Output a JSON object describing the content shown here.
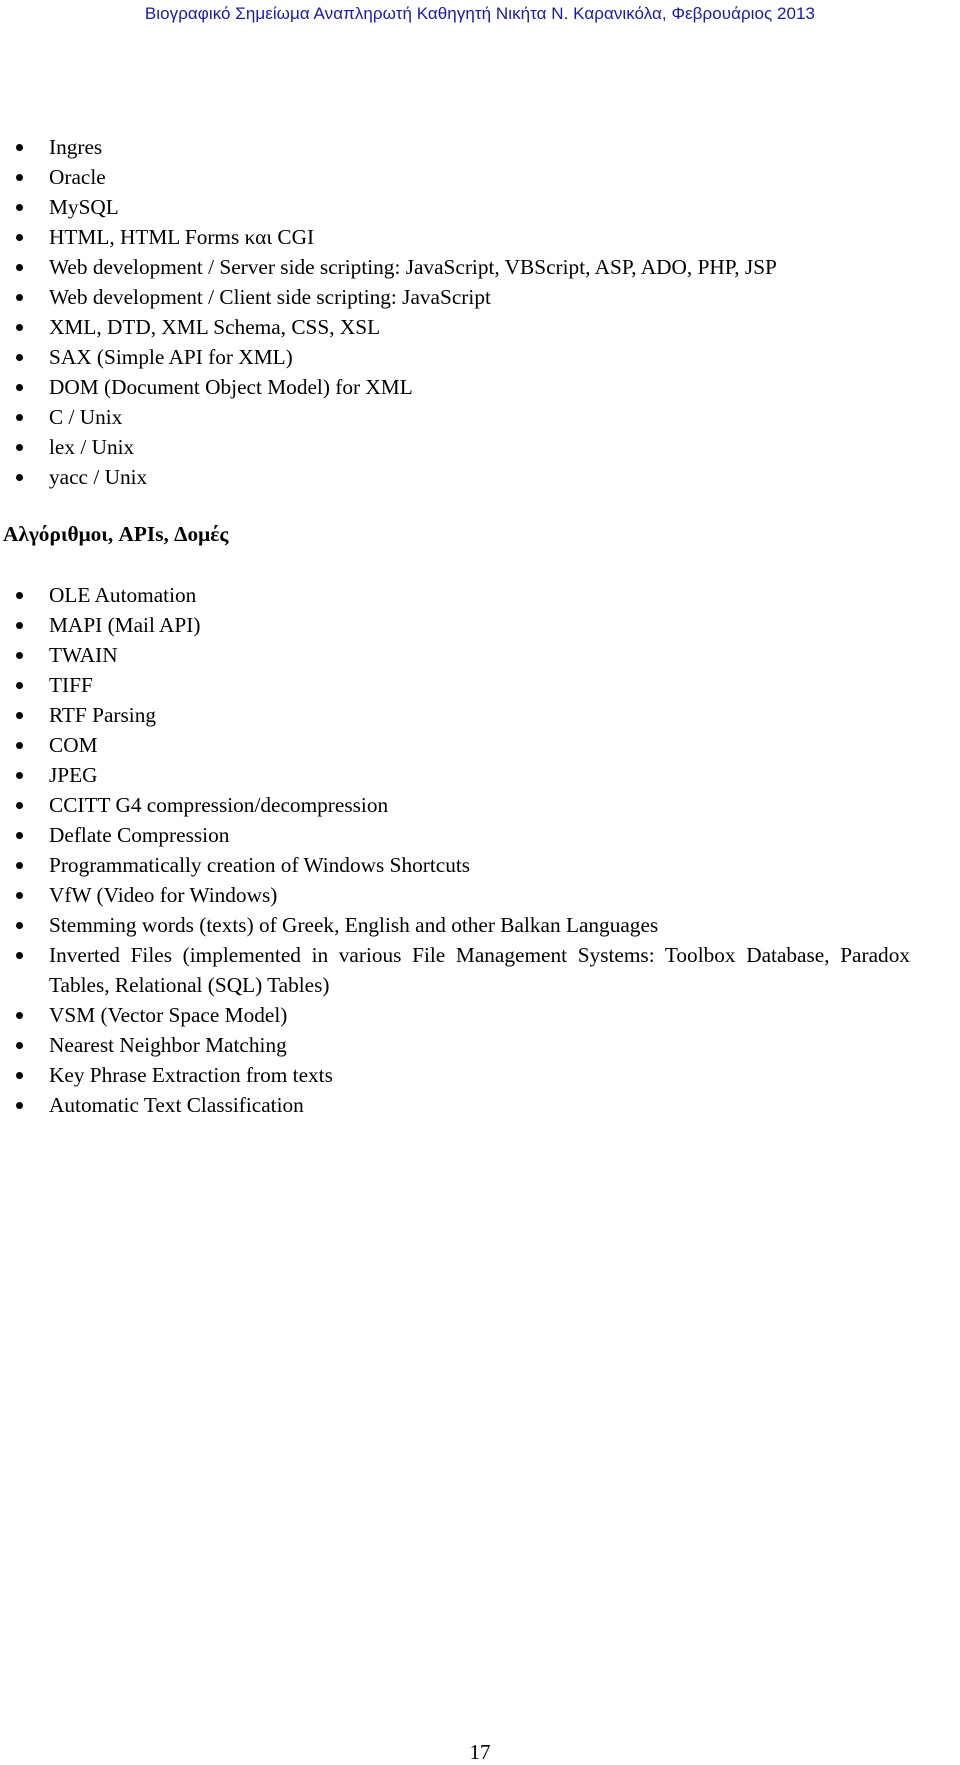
{
  "header": {
    "title": "Βιογραφικό Σημείωμα Αναπληρωτή Καθηγητή Νικήτα Ν. Καρανικόλα, Φεβρουάριος 2013",
    "color": "#1a1aa6"
  },
  "list1": {
    "items": [
      "Ingres",
      "Oracle",
      "MySQL",
      "HTML, HTML Forms και CGI",
      "Web development / Server side scripting: JavaScript, VBScript, ASP, ADO, PHP, JSP",
      "Web development / Client side scripting: JavaScript",
      "XML, DTD, XML Schema, CSS, XSL",
      "SAX (Simple API for XML)",
      "DOM (Document Object Model) for XML",
      "C / Unix",
      "lex / Unix",
      "yacc / Unix"
    ]
  },
  "section": {
    "heading": "Αλγόριθμοι, APIs, Δομές"
  },
  "list2": {
    "items": [
      "OLE Automation",
      "MAPI (Mail API)",
      "TWAIN",
      "TIFF",
      "RTF Parsing",
      "COM",
      "JPEG",
      "CCITT G4 compression/decompression",
      "Deflate Compression",
      "Programmatically creation of Windows Shortcuts",
      "VfW (Video for Windows)",
      "Stemming words (texts) of Greek, English and other Balkan Languages",
      "Inverted Files (implemented in various File Management Systems: Toolbox Database, Paradox Tables, Relational (SQL) Tables)",
      "VSM (Vector Space Model)",
      "Nearest Neighbor Matching",
      "Key Phrase Extraction from texts",
      "Automatic Text Classification"
    ]
  },
  "footer": {
    "page_number": "17"
  }
}
